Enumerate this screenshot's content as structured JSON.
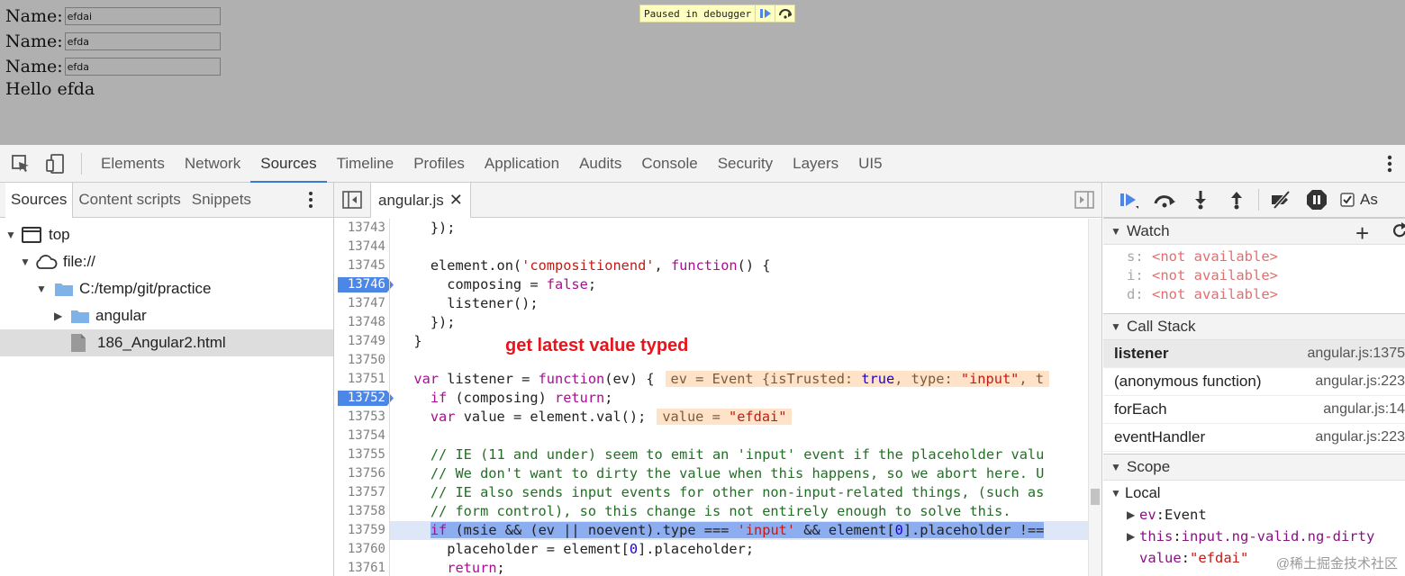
{
  "page": {
    "inputs": [
      {
        "label": "Name:",
        "value": "efdai"
      },
      {
        "label": "Name:",
        "value": "efda"
      },
      {
        "label": "Name:",
        "value": "efda"
      }
    ],
    "hello": "Hello efda",
    "paused_label": "Paused in debugger"
  },
  "toolbar": {
    "tabs": [
      "Elements",
      "Network",
      "Sources",
      "Timeline",
      "Profiles",
      "Application",
      "Audits",
      "Console",
      "Security",
      "Layers",
      "UI5"
    ],
    "active_tab": "Sources"
  },
  "navigator": {
    "tabs": [
      "Sources",
      "Content scripts",
      "Snippets"
    ],
    "tree": [
      {
        "label": "top",
        "icon": "frame-icon",
        "expanded": true
      },
      {
        "label": "file://",
        "icon": "cloud-icon",
        "expanded": true
      },
      {
        "label": "C:/temp/git/practice",
        "icon": "folder-icon",
        "expanded": true
      },
      {
        "label": "angular",
        "icon": "folder-icon",
        "expanded": false
      },
      {
        "label": "186_Angular2.html",
        "icon": "file-icon",
        "selected": true
      }
    ]
  },
  "editor": {
    "file_tab": "angular.js",
    "annotation": "get latest value typed",
    "lines": [
      {
        "n": "13743",
        "code": "    });"
      },
      {
        "n": "13744",
        "code": ""
      },
      {
        "n": "13745",
        "code": "    element.on('compositionend', function() {"
      },
      {
        "n": "13746",
        "code": "      composing = false;",
        "breakpoint": true
      },
      {
        "n": "13747",
        "code": "      listener();"
      },
      {
        "n": "13748",
        "code": "    });"
      },
      {
        "n": "13749",
        "code": "  }"
      },
      {
        "n": "13750",
        "code": ""
      },
      {
        "n": "13751",
        "code": "  var listener = function(ev) {",
        "inline": "ev = Event {isTrusted: true, type: \"input\", t"
      },
      {
        "n": "13752",
        "code": "    if (composing) return;",
        "breakpoint": true
      },
      {
        "n": "13753",
        "code": "    var value = element.val();",
        "inline": "value = \"efdai\""
      },
      {
        "n": "13754",
        "code": ""
      },
      {
        "n": "13755",
        "code": "    // IE (11 and under) seem to emit an 'input' event if the placeholder valu"
      },
      {
        "n": "13756",
        "code": "    // We don't want to dirty the value when this happens, so we abort here. U"
      },
      {
        "n": "13757",
        "code": "    // IE also sends input events for other non-input-related things, (such as"
      },
      {
        "n": "13758",
        "code": "    // form control), so this change is not entirely enough to solve this."
      },
      {
        "n": "13759",
        "code": "    if (msie && (ev || noevent).type === 'input' && element[0].placeholder !==",
        "current": true
      },
      {
        "n": "13760",
        "code": "      placeholder = element[0].placeholder;"
      },
      {
        "n": "13761",
        "code": "      return;"
      }
    ]
  },
  "debugger": {
    "watch_title": "Watch",
    "watch": [
      {
        "name": "s",
        "value": "<not available>"
      },
      {
        "name": "i",
        "value": "<not available>"
      },
      {
        "name": "d",
        "value": "<not available>"
      }
    ],
    "callstack_title": "Call Stack",
    "callstack": [
      {
        "fn": "listener",
        "loc": "angular.js:1375",
        "active": true
      },
      {
        "fn": "(anonymous function)",
        "loc": "angular.js:223"
      },
      {
        "fn": "forEach",
        "loc": "angular.js:14"
      },
      {
        "fn": "eventHandler",
        "loc": "angular.js:223"
      }
    ],
    "scope_title": "Scope",
    "local_title": "Local",
    "scope": [
      {
        "key": "ev",
        "value": "Event",
        "kind": "plain"
      },
      {
        "key": "this",
        "value": "input.ng-valid.ng-dirty",
        "kind": "obj"
      },
      {
        "key": "value",
        "value": "\"efdai\"",
        "kind": "str"
      }
    ],
    "async_label": "As"
  },
  "watermark": "@稀土掘金技术社区",
  "colors": {
    "accent": "#3879d9",
    "breakpoint": "#4c86e6",
    "annotation": "#e8141c"
  }
}
